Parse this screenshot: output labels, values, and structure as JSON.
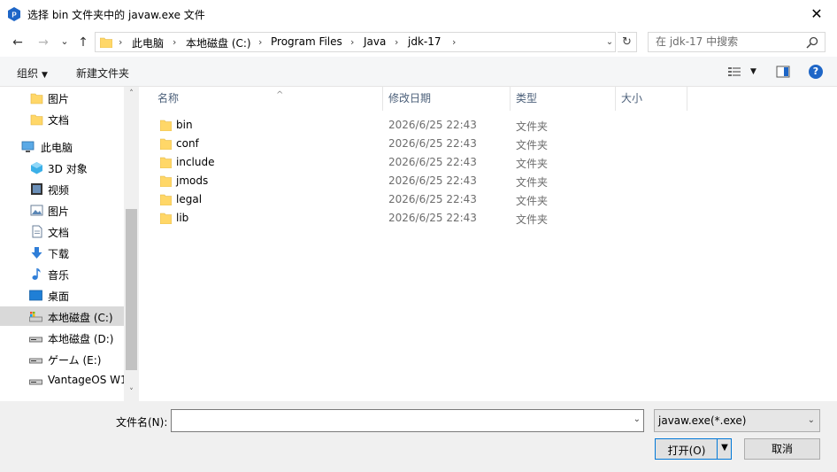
{
  "window": {
    "title": "选择 bin 文件夹中的 javaw.exe 文件",
    "close_glyph": "✕"
  },
  "address": {
    "back_glyph": "←",
    "forward_glyph": "→",
    "recent_glyph": "⌄",
    "up_glyph": "↑",
    "crumbs": [
      "此电脑",
      "本地磁盘 (C:)",
      "Program Files",
      "Java",
      "jdk-17"
    ],
    "sep_glyph": "›",
    "dropdown_glyph": "⌄",
    "refresh_glyph": "↻"
  },
  "search": {
    "placeholder": "在 jdk-17 中搜索"
  },
  "toolbar": {
    "organize_label": "组织",
    "new_folder_label": "新建文件夹",
    "help_label": "?"
  },
  "nav": {
    "items": [
      {
        "label": "图片",
        "icon": "folder-icon"
      },
      {
        "label": "文档",
        "icon": "folder-icon"
      },
      {
        "label": "此电脑",
        "icon": "computer-icon"
      },
      {
        "label": "3D 对象",
        "icon": "3d-objects-icon"
      },
      {
        "label": "视频",
        "icon": "video-icon"
      },
      {
        "label": "图片",
        "icon": "pictures-icon"
      },
      {
        "label": "文档",
        "icon": "documents-icon"
      },
      {
        "label": "下载",
        "icon": "download-icon"
      },
      {
        "label": "音乐",
        "icon": "music-icon"
      },
      {
        "label": "桌面",
        "icon": "desktop-icon"
      },
      {
        "label": "本地磁盘 (C:)",
        "icon": "drive-c-icon"
      },
      {
        "label": "本地磁盘 (D:)",
        "icon": "drive-icon"
      },
      {
        "label": "ゲーム (E:)",
        "icon": "drive-icon"
      },
      {
        "label": "VantageOS W1",
        "icon": "drive-icon"
      }
    ],
    "scroll_up_glyph": "˄",
    "scroll_down_glyph": "˅"
  },
  "columns": {
    "name": "名称",
    "modified": "修改日期",
    "type": "类型",
    "size": "大小",
    "sort_glyph": "^"
  },
  "files": [
    {
      "name": "bin",
      "modified": "2026/6/25 22:43",
      "type": "文件夹"
    },
    {
      "name": "conf",
      "modified": "2026/6/25 22:43",
      "type": "文件夹"
    },
    {
      "name": "include",
      "modified": "2026/6/25 22:43",
      "type": "文件夹"
    },
    {
      "name": "jmods",
      "modified": "2026/6/25 22:43",
      "type": "文件夹"
    },
    {
      "name": "legal",
      "modified": "2026/6/25 22:43",
      "type": "文件夹"
    },
    {
      "name": "lib",
      "modified": "2026/6/25 22:43",
      "type": "文件夹"
    }
  ],
  "bottom": {
    "filename_label": "文件名(N):",
    "filename_value": "",
    "filter_value": "javaw.exe(*.exe)",
    "open_label": "打开(O)",
    "cancel_label": "取消",
    "dd_glyph": "⌄",
    "caret_glyph": "▼"
  },
  "colors": {
    "accent": "#0078d7",
    "selected": "#cce8ff",
    "folder": "#ffd768"
  }
}
